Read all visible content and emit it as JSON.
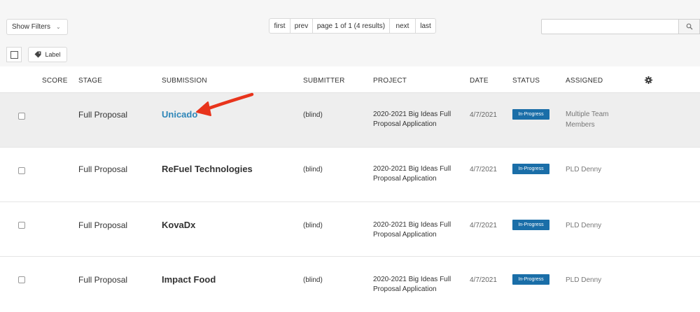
{
  "toolbar": {
    "show_filters": "Show Filters",
    "label": "Label",
    "search_placeholder": ""
  },
  "pagination": {
    "first": "first",
    "prev": "prev",
    "info": "page 1 of 1 (4 results)",
    "next": "next",
    "last": "last"
  },
  "columns": {
    "score": "SCORE",
    "stage": "STAGE",
    "submission": "SUBMISSION",
    "submitter": "SUBMITTER",
    "project": "PROJECT",
    "date": "DATE",
    "status": "STATUS",
    "assigned": "ASSIGNED"
  },
  "rows": [
    {
      "stage": "Full Proposal",
      "submission": "Unicado",
      "submitter": "(blind)",
      "project": "2020-2021 Big Ideas Full Proposal Application",
      "date": "4/7/2021",
      "status": "In-Progress",
      "assigned": "Multiple Team Members"
    },
    {
      "stage": "Full Proposal",
      "submission": "ReFuel Technologies",
      "submitter": "(blind)",
      "project": "2020-2021 Big Ideas Full Proposal Application",
      "date": "4/7/2021",
      "status": "In-Progress",
      "assigned": "PLD Denny"
    },
    {
      "stage": "Full Proposal",
      "submission": "KovaDx",
      "submitter": "(blind)",
      "project": "2020-2021 Big Ideas Full Proposal Application",
      "date": "4/7/2021",
      "status": "In-Progress",
      "assigned": "PLD Denny"
    },
    {
      "stage": "Full Proposal",
      "submission": "Impact Food",
      "submitter": "(blind)",
      "project": "2020-2021 Big Ideas Full Proposal Application",
      "date": "4/7/2021",
      "status": "In-Progress",
      "assigned": "PLD Denny"
    }
  ],
  "colors": {
    "link": "#2e86b8",
    "status_badge": "#1a6ea8",
    "annotation_arrow": "#e8341c",
    "highlight_row": "#eeeeee"
  }
}
